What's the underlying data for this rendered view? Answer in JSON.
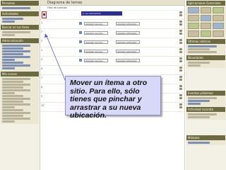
{
  "left_col": {
    "blocks": [
      {
        "title": "Personas"
      },
      {
        "title": "Actividades"
      },
      {
        "title": "Buscar en los foros"
      },
      {
        "title": "Administración"
      },
      {
        "title": "Mis cursos"
      }
    ]
  },
  "main": {
    "title": "Diagrama de temas",
    "subtitle": "Foro de noticias",
    "sections": [
      {
        "num": "1",
        "select1": "Agregar recurso...",
        "select2": "Agregar actividad..."
      },
      {
        "num": "2",
        "select1": "Agregar recurso...",
        "select2": "Agregar actividad..."
      },
      {
        "num": "3",
        "select1": "Agregar recurso...",
        "select2": "Agregar actividad..."
      },
      {
        "num": "4",
        "select1": "Agregar recurso...",
        "select2": "Agregar actividad..."
      },
      {
        "num": "5",
        "select1": "Agregar recurso...",
        "select2": "Agregar actividad..."
      },
      {
        "num": "6",
        "select1": "Agregar recurso...",
        "select2": "Agregar actividad..."
      },
      {
        "num": "7",
        "select1": "Agregar recurso...",
        "select2": "Agregar actividad..."
      },
      {
        "num": "8",
        "select1": "Agregar recurso...",
        "select2": "Agregar actividad..."
      },
      {
        "num": "9",
        "select1": "Agregar recurso...",
        "select2": "Agregar actividad..."
      },
      {
        "num": "10",
        "select1": "Agregar recurso...",
        "select2": "Agregar actividad..."
      }
    ],
    "highlighted_item": "1. La calculadora"
  },
  "callout": {
    "text": "Mover  un ítema a otro sitio. Para ello, sólo tienes que pinchar y arrastrar a su nueva ubicación."
  },
  "right_col": {
    "blocks": [
      {
        "title": "Aplicaciones Generales"
      },
      {
        "title": "Últimas noticias"
      },
      {
        "title": "Novedades"
      },
      {
        "title": "Eventos próximos"
      },
      {
        "title": "Actividad reciente"
      },
      {
        "title": "Módulos"
      }
    ]
  },
  "colors": {
    "block_header": "#6e6a3f",
    "callout_bg": "#d8d8f8",
    "highlight": "#2b2f8f",
    "red_box": "#e8242d"
  }
}
